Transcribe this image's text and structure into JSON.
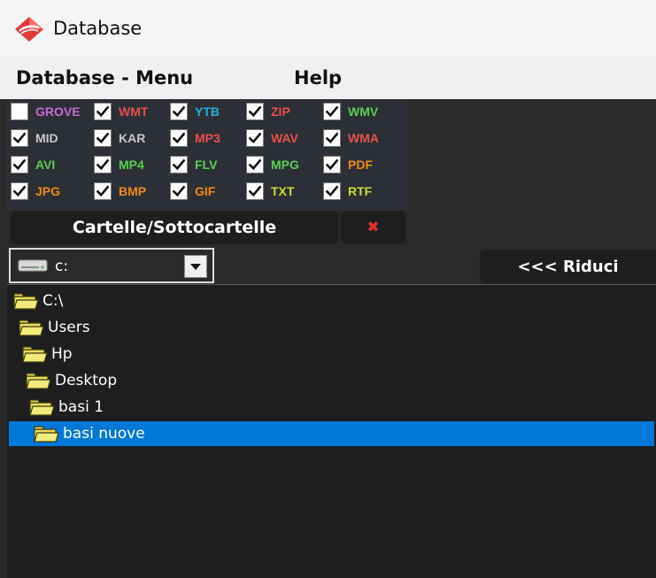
{
  "window": {
    "title": "Database",
    "icon": "app-logo-diamond-red"
  },
  "menu": {
    "items": [
      "Database - Menu",
      "Help"
    ]
  },
  "file_types": [
    {
      "label": "GROVE",
      "checked": false,
      "color": "#c86ad8"
    },
    {
      "label": "WMT",
      "checked": true,
      "color": "#e8504e"
    },
    {
      "label": "YTB",
      "checked": true,
      "color": "#25b3d8"
    },
    {
      "label": "ZIP",
      "checked": true,
      "color": "#e8504e"
    },
    {
      "label": "WMV",
      "checked": true,
      "color": "#59d050"
    },
    {
      "label": "MID",
      "checked": true,
      "color": "#c8c8c8"
    },
    {
      "label": "KAR",
      "checked": true,
      "color": "#c8c8c8"
    },
    {
      "label": "MP3",
      "checked": true,
      "color": "#e8504e"
    },
    {
      "label": "WAV",
      "checked": true,
      "color": "#e8504e"
    },
    {
      "label": "WMA",
      "checked": true,
      "color": "#e8504e"
    },
    {
      "label": "AVI",
      "checked": true,
      "color": "#59d050"
    },
    {
      "label": "MP4",
      "checked": true,
      "color": "#59d050"
    },
    {
      "label": "FLV",
      "checked": true,
      "color": "#59d050"
    },
    {
      "label": "MPG",
      "checked": true,
      "color": "#59d050"
    },
    {
      "label": "PDF",
      "checked": true,
      "color": "#f08a1c"
    },
    {
      "label": "JPG",
      "checked": true,
      "color": "#f08a1c"
    },
    {
      "label": "BMP",
      "checked": true,
      "color": "#f08a1c"
    },
    {
      "label": "GIF",
      "checked": true,
      "color": "#f08a1c"
    },
    {
      "label": "TXT",
      "checked": true,
      "color": "#cddc39"
    },
    {
      "label": "RTF",
      "checked": true,
      "color": "#cddc39"
    }
  ],
  "buttons": {
    "folders": "Cartelle/Sottocartelle",
    "close": "✖",
    "collapse": "<<< Riduci"
  },
  "drive": {
    "value": "c:",
    "icon": "hard-drive-icon"
  },
  "tree": {
    "nodes": [
      {
        "label": "C:\\",
        "selected": false
      },
      {
        "label": "Users",
        "selected": false
      },
      {
        "label": "Hp",
        "selected": false
      },
      {
        "label": "Desktop",
        "selected": false
      },
      {
        "label": "basi 1",
        "selected": false
      },
      {
        "label": "basi nuove",
        "selected": true
      }
    ]
  },
  "colors": {
    "accent_red": "#e03030",
    "selection_blue": "#0078d7",
    "panel_dark": "#2a2a2a"
  }
}
